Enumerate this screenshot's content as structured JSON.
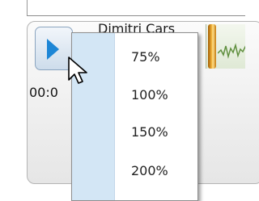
{
  "player": {
    "track_title": "Dimitri Cars",
    "time": "00:0",
    "play_icon": "play-icon"
  },
  "menu": {
    "items": [
      {
        "label": "75%"
      },
      {
        "label": "100%"
      },
      {
        "label": "150%"
      },
      {
        "label": "200%"
      }
    ]
  },
  "colors": {
    "play_accent": "#1d86d6",
    "menu_gutter": "#d3e6f5"
  }
}
